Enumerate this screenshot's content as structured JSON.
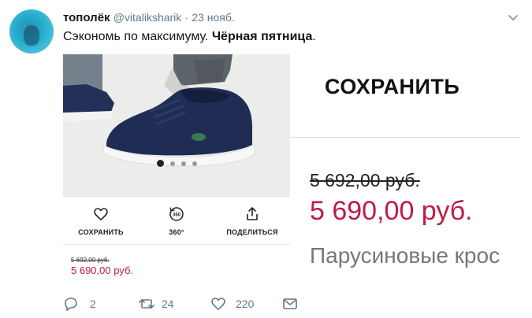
{
  "user": {
    "name": "тополёк",
    "handle": "@vitaliksharik",
    "separator": "·",
    "date": "23 нояб."
  },
  "tweet": {
    "text_plain": "Сэкономь по максимуму. ",
    "text_bold": "Чёрная пятница",
    "text_end": "."
  },
  "media": {
    "carousel": {
      "total_dots": 4,
      "active_index": 0
    },
    "actions": [
      {
        "label": "СОХРАНИТЬ",
        "icon": "heart-icon"
      },
      {
        "label": "360°",
        "icon": "rotate-360-icon"
      },
      {
        "label": "ПОДЕЛИТЬСЯ",
        "icon": "share-icon"
      }
    ],
    "price_small": {
      "old": "5 692,00 руб.",
      "new": "5 690,00 руб."
    },
    "right_title": "СОХРАНИТЬ",
    "price_big": {
      "old": "5 692,00 руб.",
      "new": "5 690,00 руб."
    },
    "product_name": "Парусиновые крос"
  },
  "footer": {
    "replies": "2",
    "retweets": "24",
    "likes": "220"
  },
  "colors": {
    "price_red": "#c01a47",
    "muted": "#657786",
    "shoe_navy": "#1f2d54"
  }
}
